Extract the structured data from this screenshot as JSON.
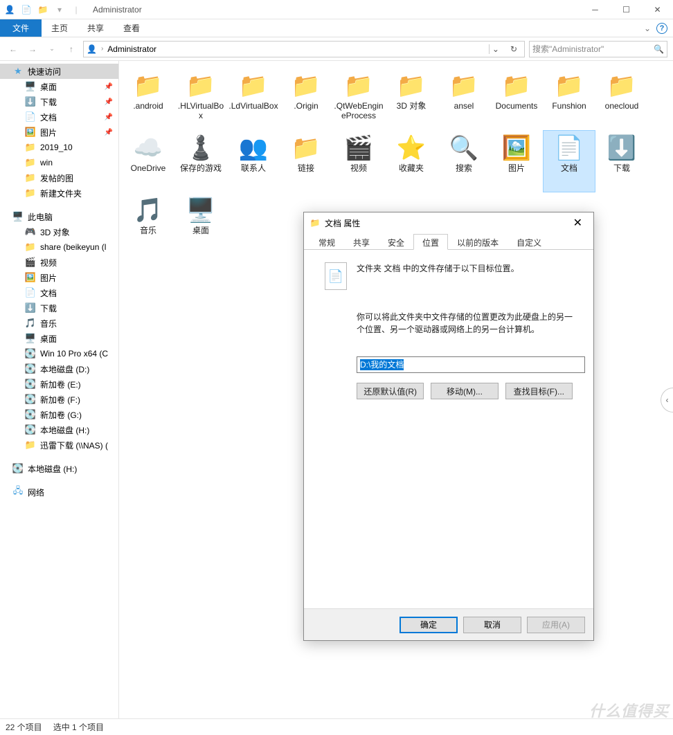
{
  "window": {
    "title": "Administrator"
  },
  "ribbon": {
    "file": "文件",
    "tabs": [
      "主页",
      "共享",
      "查看"
    ]
  },
  "address": {
    "breadcrumb": "Administrator"
  },
  "search": {
    "placeholder": "搜索\"Administrator\""
  },
  "sidebar": {
    "quick_access": "快速访问",
    "quick_items": [
      {
        "label": "桌面",
        "pin": true
      },
      {
        "label": "下载",
        "pin": true
      },
      {
        "label": "文档",
        "pin": true
      },
      {
        "label": "图片",
        "pin": true
      },
      {
        "label": "2019_10",
        "pin": false
      },
      {
        "label": "win",
        "pin": false
      },
      {
        "label": "发帖的图",
        "pin": false
      },
      {
        "label": "新建文件夹",
        "pin": false
      }
    ],
    "this_pc": "此电脑",
    "pc_items": [
      "3D 对象",
      "share (beikeyun (l",
      "视频",
      "图片",
      "文档",
      "下载",
      "音乐",
      "桌面",
      "Win 10 Pro x64 (C",
      "本地磁盘 (D:)",
      "新加卷 (E:)",
      "新加卷 (F:)",
      "新加卷 (G:)",
      "本地磁盘 (H:)",
      "迅雷下载 (\\\\NAS) ("
    ],
    "extra_drive": "本地磁盘 (H:)",
    "network": "网络"
  },
  "folders": [
    ".android",
    ".HLVirtualBox",
    ".LdVirtualBox",
    ".Origin",
    ".QtWebEngineProcess",
    "3D 对象",
    "ansel",
    "Documents",
    "Funshion",
    "onecloud",
    "OneDrive",
    "保存的游戏",
    "联系人",
    "链接",
    "视频",
    "收藏夹",
    "搜索",
    "图片",
    "文档",
    "下载",
    "音乐",
    "桌面"
  ],
  "dialog": {
    "title": "文档 属性",
    "tabs": [
      "常规",
      "共享",
      "安全",
      "位置",
      "以前的版本",
      "自定义"
    ],
    "active_tab": 3,
    "line1": "文件夹 文档 中的文件存储于以下目标位置。",
    "line2": "你可以将此文件夹中文件存储的位置更改为此硬盘上的另一个位置、另一个驱动器或网络上的另一台计算机。",
    "path": "D:\\我的文档",
    "buttons": {
      "restore": "还原默认值(R)",
      "move": "移动(M)...",
      "find": "查找目标(F)..."
    },
    "footer": {
      "ok": "确定",
      "cancel": "取消",
      "apply": "应用(A)"
    }
  },
  "status": {
    "count": "22 个项目",
    "sel": "选中 1 个项目"
  },
  "watermark": "什么值得买"
}
